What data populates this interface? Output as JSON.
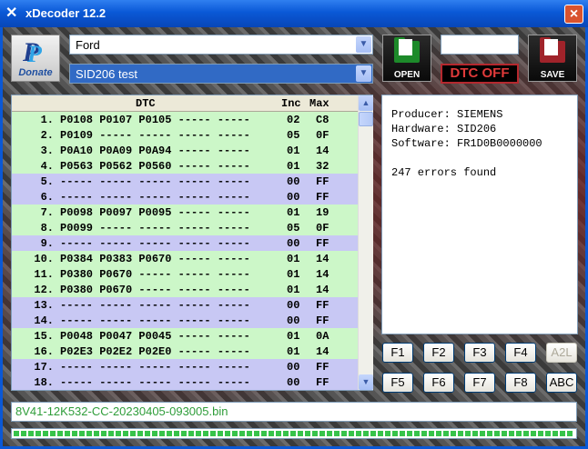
{
  "window": {
    "title": "xDecoder 12.2",
    "app_icon": "x-logo-icon",
    "close_icon": "close-icon"
  },
  "donate": {
    "label": "Donate",
    "icon": "paypal-icon"
  },
  "manufacturer": {
    "selected": "Ford"
  },
  "ecu": {
    "selected": "SID206 test"
  },
  "buttons": {
    "open": "OPEN",
    "save": "SAVE",
    "dtc_off": "DTC OFF"
  },
  "field_blank": "",
  "table": {
    "headers": {
      "dtc": "DTC",
      "inc": "Inc",
      "max": "Max"
    },
    "rows": [
      {
        "num": "1.",
        "codes": "P0108 P0107 P0105 ----- -----",
        "inc": "02",
        "max": "C8",
        "color": "green"
      },
      {
        "num": "2.",
        "codes": "P0109 ----- ----- ----- -----",
        "inc": "05",
        "max": "0F",
        "color": "green"
      },
      {
        "num": "3.",
        "codes": "P0A10 P0A09 P0A94 ----- -----",
        "inc": "01",
        "max": "14",
        "color": "green"
      },
      {
        "num": "4.",
        "codes": "P0563 P0562 P0560 ----- -----",
        "inc": "01",
        "max": "32",
        "color": "green"
      },
      {
        "num": "5.",
        "codes": "----- ----- ----- ----- -----",
        "inc": "00",
        "max": "FF",
        "color": "blue"
      },
      {
        "num": "6.",
        "codes": "----- ----- ----- ----- -----",
        "inc": "00",
        "max": "FF",
        "color": "blue"
      },
      {
        "num": "7.",
        "codes": "P0098 P0097 P0095 ----- -----",
        "inc": "01",
        "max": "19",
        "color": "green"
      },
      {
        "num": "8.",
        "codes": "P0099 ----- ----- ----- -----",
        "inc": "05",
        "max": "0F",
        "color": "green"
      },
      {
        "num": "9.",
        "codes": "----- ----- ----- ----- -----",
        "inc": "00",
        "max": "FF",
        "color": "blue"
      },
      {
        "num": "10.",
        "codes": "P0384 P0383 P0670 ----- -----",
        "inc": "01",
        "max": "14",
        "color": "green"
      },
      {
        "num": "11.",
        "codes": "P0380 P0670 ----- ----- -----",
        "inc": "01",
        "max": "14",
        "color": "green"
      },
      {
        "num": "12.",
        "codes": "P0380 P0670 ----- ----- -----",
        "inc": "01",
        "max": "14",
        "color": "green"
      },
      {
        "num": "13.",
        "codes": "----- ----- ----- ----- -----",
        "inc": "00",
        "max": "FF",
        "color": "blue"
      },
      {
        "num": "14.",
        "codes": "----- ----- ----- ----- -----",
        "inc": "00",
        "max": "FF",
        "color": "blue"
      },
      {
        "num": "15.",
        "codes": "P0048 P0047 P0045 ----- -----",
        "inc": "01",
        "max": "0A",
        "color": "green"
      },
      {
        "num": "16.",
        "codes": "P02E3 P02E2 P02E0 ----- -----",
        "inc": "01",
        "max": "14",
        "color": "green"
      },
      {
        "num": "17.",
        "codes": "----- ----- ----- ----- -----",
        "inc": "00",
        "max": "FF",
        "color": "blue"
      },
      {
        "num": "18.",
        "codes": "----- ----- ----- ----- -----",
        "inc": "00",
        "max": "FF",
        "color": "blue"
      }
    ]
  },
  "info": {
    "producer": "Producer: SIEMENS",
    "hardware": "Hardware: SID206",
    "software": "Software: FR1D0B0000000",
    "errors": "247 errors found"
  },
  "fkeys": {
    "f1": "F1",
    "f2": "F2",
    "f3": "F3",
    "f4": "F4",
    "a2l": "A2L",
    "f5": "F5",
    "f6": "F6",
    "f7": "F7",
    "f8": "F8",
    "abc": "ABC"
  },
  "status": {
    "filename": "8V41-12K532-CC-20230405-093005.bin",
    "progress": 1.0
  },
  "colors": {
    "row_green": "#ccf7c8",
    "row_blue": "#c8c8f4",
    "dtc_off_red": "#e03a3a",
    "filename_green": "#2f9d3a"
  }
}
